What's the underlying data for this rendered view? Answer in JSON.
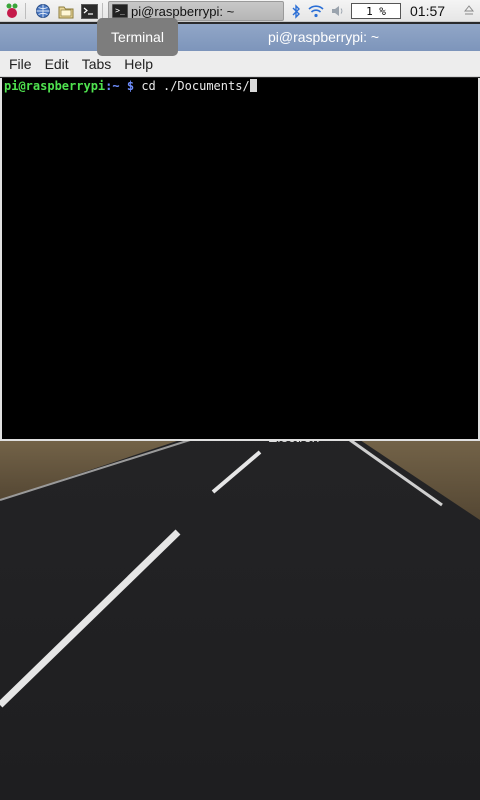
{
  "panel": {
    "task_label": "pi@raspberrypi: ~",
    "cpu_usage": "1 %",
    "clock": "01:57"
  },
  "tooltip": {
    "text": "Terminal"
  },
  "window": {
    "title": "pi@raspberrypi: ~",
    "menu": [
      "File",
      "Edit",
      "Tabs",
      "Help"
    ]
  },
  "terminal": {
    "prompt_user": "pi@raspberrypi",
    "prompt_path": ":~",
    "prompt_symbol": "$",
    "command": "cd ./Documents/"
  },
  "desktop": {
    "icon_label": "Electron"
  },
  "colors": {
    "titlebar": "#879ec3",
    "prompt_user": "#4fe24f",
    "prompt_path": "#6f8fff"
  }
}
